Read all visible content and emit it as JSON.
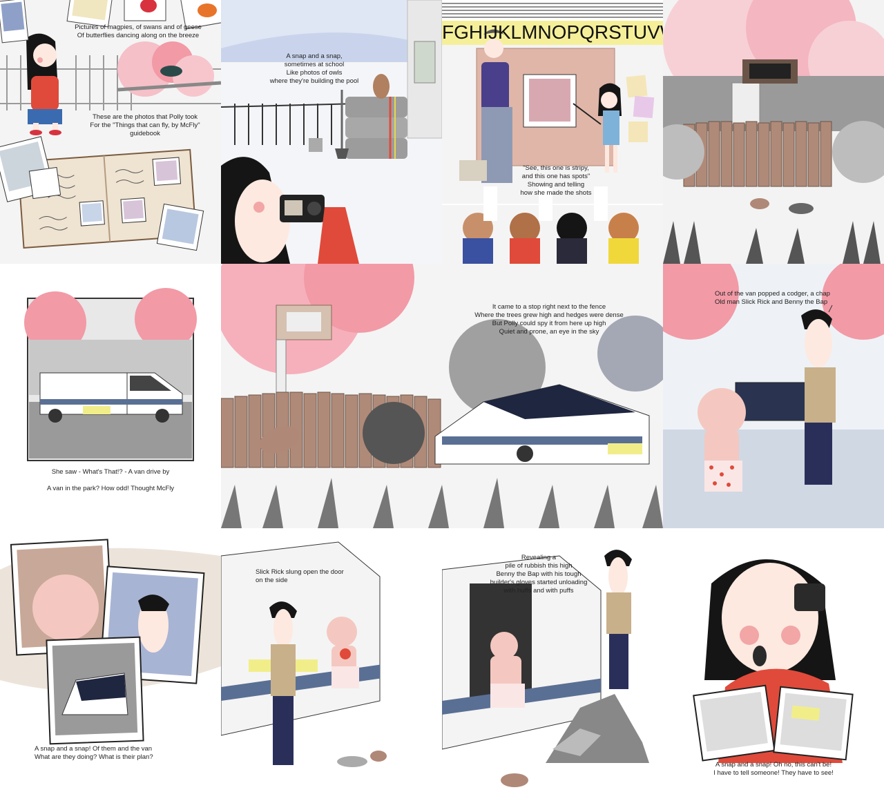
{
  "panels": [
    {
      "id": "p1",
      "caption_top": "Pictures of magpies, of swans and of geese\nOf butterflies dancing along on the breeze",
      "caption_bottom": "These are the photos that Polly took\nFor the \"Things that can fly, by McFly\" guidebook"
    },
    {
      "id": "p2",
      "caption": "A snap and a snap,\nsometimes at school\nLike photos of owls\nwhere they're building the pool"
    },
    {
      "id": "p3",
      "alphabet": "FGHIJKLMNOPQRSTUVW",
      "caption": "\"See, this one is stripy,\nand this one has spots\"\nShowing and telling\nhow she made the shots"
    },
    {
      "id": "p4"
    },
    {
      "id": "p5",
      "caption": "She saw - What's That!? - A van drive by\n\nA van in the park? How odd! Thought McFly"
    },
    {
      "id": "p6",
      "caption": "It came to a stop right next to the fence\nWhere the trees grew high and hedges were dense\nBut Polly could spy it from here up high\nQuiet and prone, an eye in the sky"
    },
    {
      "id": "p7",
      "caption": "Out of the van popped a codger, a chap\nOld man Slick Rick and Benny the Bap"
    },
    {
      "id": "p8",
      "caption": "A snap and a snap! Of them and the van\nWhat are they doing? What is their plan?"
    },
    {
      "id": "p9",
      "caption": "Slick Rick slung open the door\non the side"
    },
    {
      "id": "p10",
      "caption": "Revealing a\npile of rubbish this high\nBenny the Bap with his tough\nbuilder's gloves started unloading\nwith huffs and with puffs"
    },
    {
      "id": "p11",
      "caption": "A snap and a snap! Oh no, this can't be!\nI have to tell someone! They have to see!"
    }
  ],
  "colors": {
    "blossom": "#f29aa6",
    "van_stripe": "#5a6f94",
    "van_yellow": "#f1ee8a",
    "sweater_red": "#e04a3a",
    "hair": "#151515",
    "fence": "#b08a78"
  }
}
